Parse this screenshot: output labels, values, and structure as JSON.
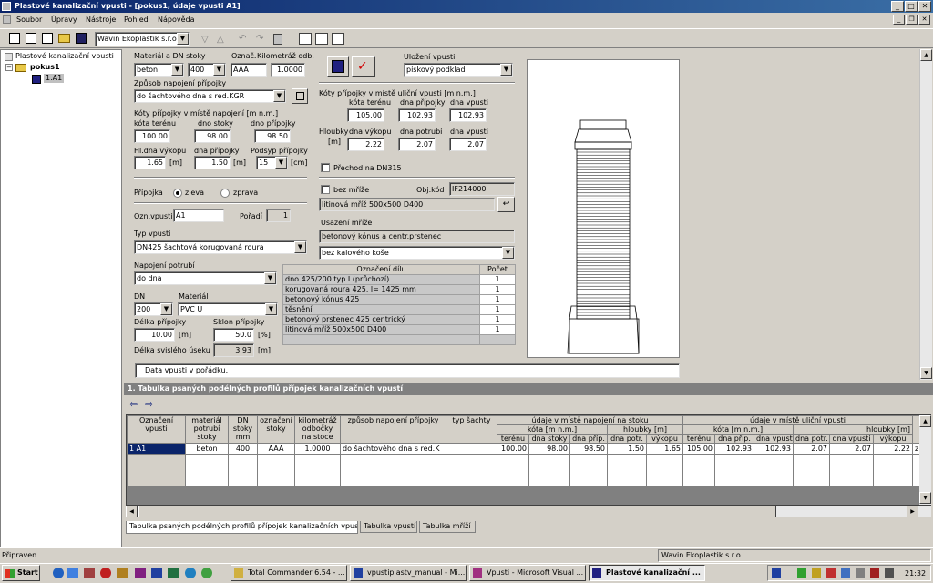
{
  "window": {
    "title": "Plastové kanalizační vpusti - [pokus1, údaje vpusti A1]"
  },
  "menu": [
    "Soubor",
    "Úpravy",
    "Nástroje",
    "Pohled",
    "Nápověda"
  ],
  "toolbar": {
    "supplier": "Wavin Ekoplastik s.r.o"
  },
  "tree": {
    "root": "Plastové kanalizační vpusti",
    "project": "pokus1",
    "item": "1.A1"
  },
  "form": {
    "material_dn_label": "Materiál a DN stoky",
    "material": "beton",
    "dn": "400",
    "oznac_label": "Označ.",
    "oznac": "AAA",
    "km_label": "Kilometráž odb.",
    "km": "1.0000",
    "connect_method_label": "Způsob napojení přípojky",
    "connect_method": "do šachtového dna s red.KGR",
    "koty_label": "Kóty přípojky v místě napojení [m n.m.]",
    "kota_tereni_label": "kóta terénu",
    "kota_tereni": "100.00",
    "dno_stoky_label": "dno stoky",
    "dno_stoky": "98.00",
    "dno_pripojky_label": "dno přípojky",
    "dno_pripojky": "98.50",
    "hl_dna_label": "Hl.dna výkopu",
    "hl_dna": "1.65",
    "unit_m": "[m]",
    "dna_pripojky_label": "dna přípojky",
    "dna_pripojky": "1.50",
    "podsyp_label": "Podsyp přípojky",
    "podsyp": "15",
    "unit_cm": "[cm]",
    "pripojka_label": "Přípojka",
    "zleva": "zleva",
    "zprava": "zprava",
    "ozn_vpusti_label": "Ozn.vpusti",
    "ozn_vpusti": "A1",
    "poradi_label": "Pořadí",
    "poradi": "1",
    "typ_vpusti_label": "Typ vpusti",
    "typ_vpusti": "DN425 šachtová korugovaná roura",
    "napojeni_label": "Napojení potrubí",
    "napojeni": "do dna",
    "dn_label": "DN",
    "dn2": "200",
    "material2_label": "Materiál",
    "material2": "PVC U",
    "delka_label": "Délka přípojky",
    "delka": "10.00",
    "sklon_label": "Sklon přípojky",
    "sklon": "50.0",
    "unit_pct": "[%]",
    "delka_svisle_label": "Délka svislého úseku",
    "delka_svisle": "3.93"
  },
  "right": {
    "ulozeni_label": "Uložení vpusti",
    "ulozeni": "pískový podklad",
    "koty_label": "Kóty přípojky v místě uliční vpusti [m n.m.]",
    "kota_tereni_label": "kóta terénu",
    "kota_tereni": "105.00",
    "dna_pripojky_label": "dna přípojky",
    "dna_pripojky": "102.93",
    "dna_vpusti_label": "dna vpusti",
    "dna_vpusti": "102.93",
    "hloubky_label": "Hloubky",
    "m_label": "[m]",
    "dna_vykopu_label": "dna výkopu",
    "dna_vykopu": "2.22",
    "dna_potrubi_label": "dna potrubí",
    "dna_potrubi": "2.07",
    "dna_vpusti2": "2.07",
    "prechod": "Přechod na DN315",
    "bez_mrize": "bez mříže",
    "objkod_label": "Obj.kód",
    "objkod": "IF214000",
    "mriz": "litinová mříž 500x500 D400",
    "usazeni_label": "Usazení mříže",
    "usazeni": "betonový kónus a centr.prstenec",
    "kos": "bez kalového koše"
  },
  "parts": {
    "headers": [
      "Označení dílu",
      "Počet"
    ],
    "rows": [
      [
        "dno 425/200 typ I (průchozí)",
        "1"
      ],
      [
        "korugovaná roura 425, l= 1425 mm",
        "1"
      ],
      [
        "betonový kónus 425",
        "1"
      ],
      [
        "těsnění",
        "1"
      ],
      [
        "betonový prstenec 425 centrický",
        "1"
      ],
      [
        "litinová mříž 500x500 D400",
        "1"
      ]
    ]
  },
  "status_msg": "Data vpusti v pořádku.",
  "bottom": {
    "title": "1. Tabulka psaných podélných profilů přípojek kanalizačních vpustí",
    "h_ozn": "Označení vpusti",
    "h_mat": "materiál potrubí stoky",
    "h_dn": "DN stoky mm",
    "h_oz": "označení stoky",
    "h_km": "kilometráž odbočky na stoce",
    "h_zp": "způsob napojení přípojky",
    "h_typ": "typ šachty",
    "h_g1": "údaje v místě napojení na stoku",
    "h_g2": "údaje v místě uliční vpusti",
    "h_kota": "kóta [m n.m.]",
    "h_hl": "hloubky [m]",
    "h_kota2": "kóta [m n.m.]",
    "h_hl2": "hloubky [m]",
    "h_pr": "př",
    "sub": [
      "terénu",
      "dna stoky",
      "dna příp.",
      "dna potr.",
      "výkopu",
      "terénu",
      "dna příp.",
      "dna vpusti",
      "dna potr.",
      "dna vpusti",
      "výkopu"
    ],
    "row": [
      "1 A1",
      "beton",
      "400",
      "AAA",
      "1.0000",
      "do šachtového dna s red.K",
      "",
      "100.00",
      "98.00",
      "98.50",
      "1.50",
      "1.65",
      "105.00",
      "102.93",
      "102.93",
      "2.07",
      "2.07",
      "2.22",
      "zl"
    ],
    "tabs": [
      "Tabulka psaných podélných profilů přípojek kanalizačních vpustí",
      "Tabulka vpustí",
      "Tabulka mříží"
    ]
  },
  "statusbar": {
    "left": "Připraven",
    "right": "Wavin Ekoplastik s.r.o"
  },
  "taskbar": {
    "start": "Start",
    "items": [
      "Total Commander 6.54 - ...",
      "vpustiplastv_manual - Mi...",
      "Vpusti - Microsoft Visual ...",
      "Plastové kanalizační ..."
    ],
    "clock": "21:32"
  }
}
